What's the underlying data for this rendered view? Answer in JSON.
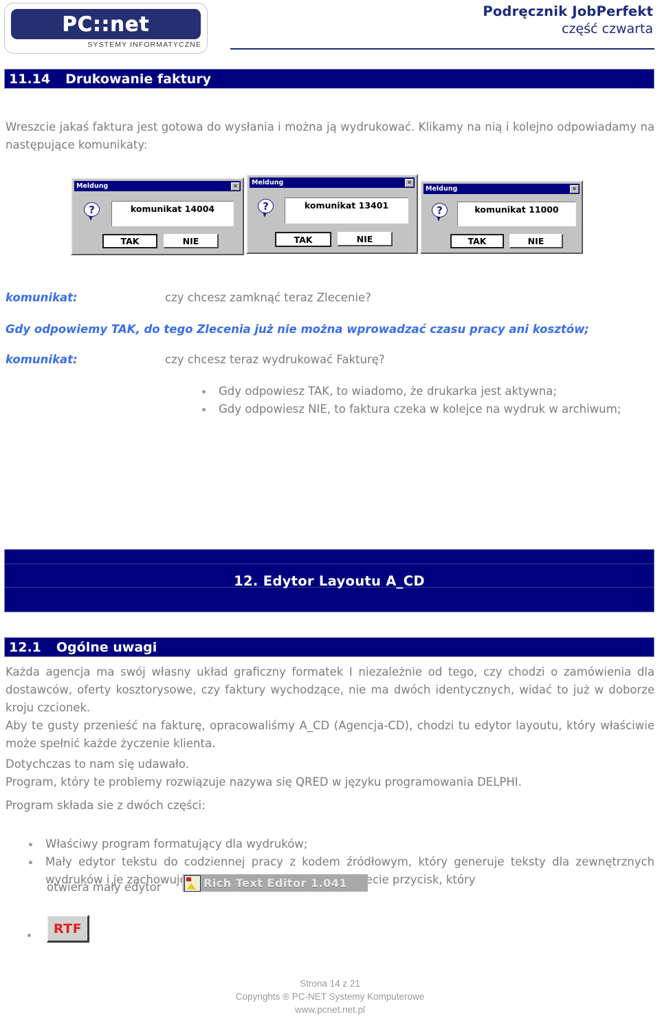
{
  "header": {
    "logo_wordmark": "PC::net",
    "logo_tagline": "SYSTEMY  INFORMATYCZNE",
    "title_main": "Podręcznik JobPerfekt",
    "title_sub": "część czwarta"
  },
  "section_1114": {
    "number": "11.14",
    "title": "Drukowanie faktury",
    "intro": "Wreszcie jakaś faktura jest gotowa do wysłania i można ją wydrukować. Klikamy na nią i kolejno odpowiadamy na następujące komunikaty:"
  },
  "dialogs": [
    {
      "window_title": "Meldung",
      "message": "komunikat 14004",
      "yes_label": "TAK",
      "no_label": "NIE",
      "close_label": "✕"
    },
    {
      "window_title": "Meldung",
      "message": "komunikat 13401",
      "yes_label": "TAK",
      "no_label": "NIE",
      "close_label": "✕"
    },
    {
      "window_title": "Meldung",
      "message": "komunikat 11000",
      "yes_label": "TAK",
      "no_label": "NIE",
      "close_label": "✕"
    }
  ],
  "komunikaty": {
    "row1_label": "komunikat:",
    "row1_value": "czy chcesz zamknąć teraz Zlecenie?",
    "note": "Gdy odpowiemy TAK, do tego Zlecenia już nie można wprowadzać czasu pracy ani kosztów;",
    "row2_label": "komunikat:",
    "row2_value": "czy chcesz teraz wydrukować Fakturę?",
    "bullets": [
      "Gdy odpowiesz TAK, to wiadomo, że drukarka jest aktywna;",
      "Gdy odpowiesz NIE, to faktura czeka w kolejce na wydruk w archiwum;"
    ]
  },
  "chapter_12": {
    "title": "12.  Edytor Layoutu   A_CD"
  },
  "section_121": {
    "number": "12.1",
    "title": "Ogólne uwagi",
    "para1": "Każda agencja ma  swój własny układ graficzny formatek I niezależnie od tego, czy chodzi o zamówienia dla dostawców, oferty kosztorysowe, czy faktury wychodzące, nie ma dwóch identycznych, widać to już w doborze kroju czcionek.",
    "para2": "Aby te gusty przenieść na fakturę, opracowaliśmy A_CD (Agencja-CD), chodzi tu edytor layoutu, który właściwie może spełnić  każde życzenie klienta.",
    "para3": "Dotychczas to nam  się udawało.\nProgram, który te problemy rozwiązuje nazywa się  QRED w języku programowania DELPHI.",
    "para4": "Program składa sie z dwóch części:",
    "bullets": [
      "Właściwy program formatujący dla wydruków;",
      "Mały edytor tekstu do codziennej pracy z kodem źródłowym, który generuje teksty dla zewnętrznych wydruków i je zachowuje. Wszędzie w programie znajdziecie przycisk, który"
    ],
    "open_editor_text": "otwiera mały edytor",
    "rte_button_label": "Rich Text Editor 1.041",
    "rtf_button_label": "RTF"
  },
  "footer": {
    "page": "Strona 14 z 21",
    "copyright": "Copyrights ® PC-NET Systemy Komputerowe",
    "website": "www.pcnet.net.pl"
  }
}
